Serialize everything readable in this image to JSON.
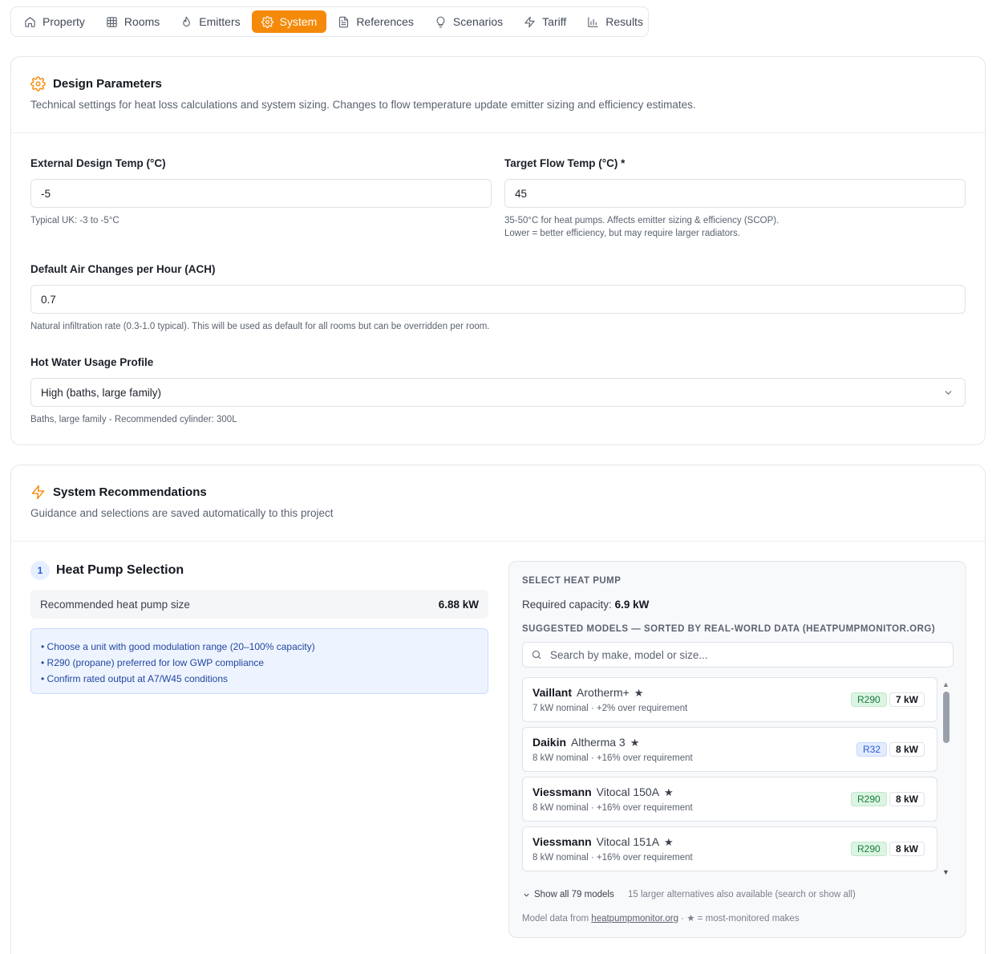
{
  "tabs": [
    {
      "label": "Property",
      "icon": "home-icon"
    },
    {
      "label": "Rooms",
      "icon": "grid-icon"
    },
    {
      "label": "Emitters",
      "icon": "flame-icon"
    },
    {
      "label": "System",
      "icon": "gear-icon",
      "active": true
    },
    {
      "label": "References",
      "icon": "document-icon"
    },
    {
      "label": "Scenarios",
      "icon": "lightbulb-icon"
    },
    {
      "label": "Tariff",
      "icon": "bolt-icon"
    },
    {
      "label": "Results",
      "icon": "bar-chart-icon"
    }
  ],
  "colors": {
    "accent": "#f58a0a",
    "r290": "#1b7a3a",
    "r32": "#2a5bd7"
  },
  "design": {
    "title": "Design Parameters",
    "subtitle": "Technical settings for heat loss calculations and system sizing. Changes to flow temperature update emitter sizing and efficiency estimates.",
    "external_temp": {
      "label": "External Design Temp (°C)",
      "value": "-5",
      "hint": "Typical UK: -3 to -5°C"
    },
    "flow_temp": {
      "label": "Target Flow Temp (°C) *",
      "value": "45",
      "hint1": "35-50°C for heat pumps. Affects emitter sizing & efficiency (SCOP).",
      "hint2": "Lower = better efficiency, but may require larger radiators."
    },
    "ach": {
      "label": "Default Air Changes per Hour (ACH)",
      "value": "0.7",
      "hint": "Natural infiltration rate (0.3-1.0 typical). This will be used as default for all rooms but can be overridden per room."
    },
    "hot_water": {
      "label": "Hot Water Usage Profile",
      "value": "High (baths, large family)",
      "hint": "Baths, large family - Recommended cylinder: 300L"
    }
  },
  "recommendations": {
    "title": "System Recommendations",
    "subtitle": "Guidance and selections are saved automatically to this project",
    "step_number": "1",
    "step_title": "Heat Pump Selection",
    "rec_label": "Recommended heat pump size",
    "rec_value": "6.88 kW",
    "tips": [
      "• Choose a unit with good modulation range (20–100% capacity)",
      "• R290 (propane) preferred for low GWP compliance",
      "• Confirm rated output at A7/W45 conditions"
    ],
    "panel": {
      "caption": "SELECT HEAT PUMP",
      "required_label": "Required capacity: ",
      "required_value": "6.9 kW",
      "suggested_caption": "SUGGESTED MODELS — SORTED BY REAL-WORLD DATA (HEATPUMPMONITOR.ORG)",
      "search_placeholder": "Search by make, model or size...",
      "models": [
        {
          "make": "Vaillant",
          "model": "Arotherm+",
          "star": "★",
          "desc": "7 kW nominal · +2% over requirement",
          "refrigerant": "R290",
          "kw": "7 kW"
        },
        {
          "make": "Daikin",
          "model": "Altherma 3",
          "star": "★",
          "desc": "8 kW nominal · +16% over requirement",
          "refrigerant": "R32",
          "kw": "8 kW"
        },
        {
          "make": "Viessmann",
          "model": "Vitocal 150A",
          "star": "★",
          "desc": "8 kW nominal · +16% over requirement",
          "refrigerant": "R290",
          "kw": "8 kW"
        },
        {
          "make": "Viessmann",
          "model": "Vitocal 151A",
          "star": "★",
          "desc": "8 kW nominal · +16% over requirement",
          "refrigerant": "R290",
          "kw": "8 kW"
        }
      ],
      "show_all": "Show all 79 models",
      "alt_note": "15 larger alternatives also available (search or show all)",
      "credit_prefix": "Model data from ",
      "credit_link": "heatpumpmonitor.org",
      "credit_suffix": " · ★ = most-monitored makes"
    }
  }
}
